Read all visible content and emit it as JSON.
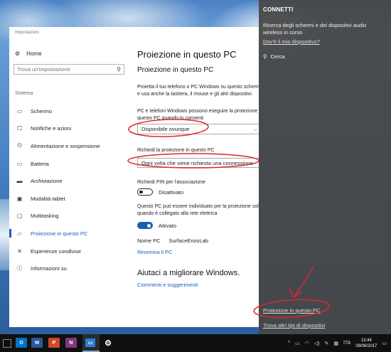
{
  "window": {
    "title": "Impostazioni"
  },
  "nav": {
    "home": "Home",
    "search_placeholder": "Trova un'impostazione",
    "section": "Sistema",
    "items": [
      {
        "label": "Schermo",
        "icon": "monitor-icon"
      },
      {
        "label": "Notifiche e azioni",
        "icon": "notifications-icon"
      },
      {
        "label": "Alimentazione e sospensione",
        "icon": "power-icon"
      },
      {
        "label": "Batteria",
        "icon": "battery-icon"
      },
      {
        "label": "Archiviazione",
        "icon": "storage-icon"
      },
      {
        "label": "Modalità tablet",
        "icon": "tablet-icon"
      },
      {
        "label": "Multitasking",
        "icon": "multitasking-icon"
      },
      {
        "label": "Proiezione in questo PC",
        "icon": "projection-icon",
        "active": true
      },
      {
        "label": "Esperienze condivise",
        "icon": "shared-experiences-icon"
      },
      {
        "label": "Informazioni su",
        "icon": "info-icon"
      }
    ]
  },
  "content": {
    "page_title": "Proiezione in questo PC",
    "sub_title": "Proiezione in questo PC",
    "intro": "Proietta il tuo telefono o PC Windows su questo schermo e usa anche la tastiera, il mouse e gli altri dispositivi.",
    "setting1_label": "PC e telefoni Windows possono eseguire la proiezione in questo PC quando lo consenti",
    "setting1_value": "Disponibile ovunque",
    "setting2_label": "Richiedi la proiezione in questo PC",
    "setting2_value": "Ogni volta che viene richiesta una connessione",
    "pin_label": "Richiedi PIN per l'associazione",
    "pin_state": "Disattivato",
    "power_label": "Questo PC può essere individuato per la proiezione solo quando è collegato alla rete elettrica",
    "power_state": "Attivato",
    "pc_name_label": "Nome PC",
    "pc_name_value": "SurfaceEnzoLab",
    "rename_link": "Rinomina il PC",
    "help_title": "Aiutaci a migliorare Windows.",
    "feedback_link": "Commenti e suggerimenti"
  },
  "connect": {
    "title": "CONNETTI",
    "description": "Ricerca degli schermi e dei dispositivi audio wireless in corso",
    "where_link": "Dov'è il mio dispositivo?",
    "search": "Cerca",
    "projection_link": "Proiezione in questo PC",
    "other_link": "Trova altri tipi di dispositivi"
  },
  "taskbar": {
    "apps": [
      {
        "icon": "outlook-icon",
        "label": "O",
        "color": "#0072c6"
      },
      {
        "icon": "word-icon",
        "label": "W",
        "color": "#2b579a"
      },
      {
        "icon": "powerpoint-icon",
        "label": "P",
        "color": "#d24726"
      },
      {
        "icon": "onenote-icon",
        "label": "N",
        "color": "#80397b"
      }
    ],
    "language": "ITA",
    "time": "13:44",
    "date": "09/06/2017"
  }
}
